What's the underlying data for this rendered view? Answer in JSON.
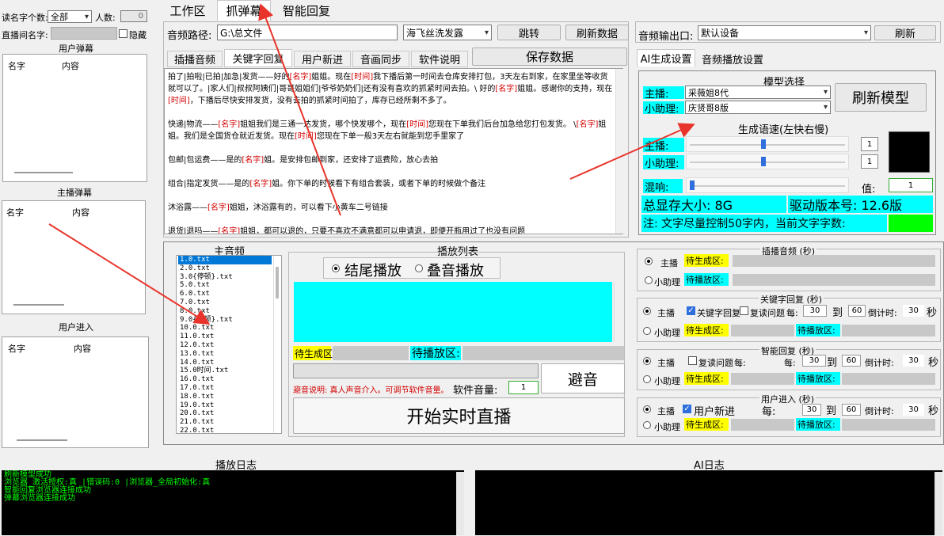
{
  "left": {
    "read_count_label": "读名字个数:",
    "read_count_value": "全部",
    "people_label": "人数:",
    "people_value": "0",
    "room_label": "直播间名字:",
    "hide_label": "隐藏",
    "user_danmu_title": "用户弹幕",
    "host_danmu_title": "主播弹幕",
    "user_enter_title": "用户进入",
    "col_name": "名字",
    "col_content": "内容"
  },
  "tabs": [
    "工作区",
    "抓弹幕",
    "智能回复"
  ],
  "audio_path_label": "音频路径:",
  "audio_path_value": "G:\\总文件",
  "voice_select": "海飞丝洗发露",
  "jump_button": "跳转",
  "refresh_data_button": "刷新数据",
  "audio_out_label": "音频输出口:",
  "audio_out_value": "默认设备",
  "refresh_button": "刷新",
  "subtabs": [
    "插播音频",
    "关键字回复",
    "用户新进",
    "音画同步",
    "软件说明"
  ],
  "save_button": "保存数据",
  "right_tabs": [
    "AI生成设置",
    "音频播放设置"
  ],
  "script_lines": [
    [
      [
        "拍了|拍啦|已拍|加急|发货——好的",
        0
      ],
      [
        "[名字]",
        1
      ],
      [
        "姐姐。现在",
        0
      ],
      [
        "[时间]",
        1
      ],
      [
        "我下播后第一时间去仓库安排打包，3天左右到家，在家里坐等收货就可以了。|家人们|叔叔阿姨们|哥哥姐姐们|爷爷奶奶们|还有没有喜欢的抓紧时间去拍。\\    好的",
        0
      ],
      [
        "[名字]",
        1
      ],
      [
        "姐姐。感谢你的支持，现在",
        0
      ],
      [
        "[时间]",
        1
      ],
      [
        "，下播后尽快安排发货，没有去拍的抓紧时间拍了，库存已经所剩不多了。",
        0
      ]
    ],
    [
      [
        "快递|物流——",
        0
      ],
      [
        "[名字]",
        1
      ],
      [
        "姐姐我们是三通一达发货，哪个快发哪个，现在",
        0
      ],
      [
        "[时间]",
        1
      ],
      [
        "您现在下单我们后台加急给您打包发货。      \\",
        0
      ],
      [
        "[名字]",
        1
      ],
      [
        "姐姐。我们是全国货仓就近发货。现在",
        0
      ],
      [
        "[时间]",
        1
      ],
      [
        "您现在下单一般3天左右就能到您手里家了",
        0
      ]
    ],
    [
      [
        "包邮|包运费——是的",
        0
      ],
      [
        "[名字]",
        1
      ],
      [
        "姐。是安排包邮到家，还安排了运费险，放心去拍",
        0
      ]
    ],
    [
      [
        "组合|指定发货——是的",
        0
      ],
      [
        "[名字]",
        1
      ],
      [
        "姐。你下单的时候看下有组合套装，或者下单的时候做个备注",
        0
      ]
    ],
    [
      [
        "沐浴露——",
        0
      ],
      [
        "[名字]",
        1
      ],
      [
        "姐姐，沐浴露有的，可以看下小黄车二号链接",
        0
      ]
    ],
    [
      [
        "退货|退吗——",
        0
      ],
      [
        "[名字]",
        1
      ],
      [
        "姐姐，都可以退的，只要不喜欢不满意都可以申请退，即便开瓶用过了也没有问题",
        0
      ]
    ]
  ],
  "model": {
    "title": "模型选择",
    "host_label": "主播:",
    "host_value": "采薇姐8代",
    "assist_label": "小助理:",
    "assist_value": "庆贤哥8版",
    "refresh_button": "刷新模型",
    "speed_title": "生成语速(左快右慢)",
    "speed_host_value": "1",
    "speed_assist_value": "1",
    "reverb_label": "混响:",
    "reverb_value_label": "值:",
    "reverb_value": "1",
    "vram": "总显存大小: 8G",
    "driver": "驱动版本号: 12.6版",
    "note": "注: 文字尽量控制50字内，当前文字字数:"
  },
  "host_audio": {
    "title": "主音频",
    "items": [
      "1.0.txt",
      "2.0.txt",
      "3.0{停顿}.txt",
      "5.0.txt",
      "6.0.txt",
      "7.0.txt",
      "8.0.txt",
      "9.0{停顿}.txt",
      "10.0.txt",
      "11.0.txt",
      "12.0.txt",
      "13.0.txt",
      "14.0.txt",
      "15.0时间.txt",
      "16.0.txt",
      "17.0.txt",
      "18.0.txt",
      "19.0.txt",
      "20.0.txt",
      "21.0.txt",
      "22.0.txt"
    ]
  },
  "playlist": {
    "title": "播放列表",
    "mode_end": "结尾播放",
    "mode_overlay": "叠音播放",
    "pending_gen": "待生成区:",
    "pending_play": "待播放区:",
    "avoid_button": "避音",
    "avoid_note": "避音说明: 真人声音介入。可调节软件音量。",
    "volume_label": "软件音量:",
    "volume_value": "1",
    "start_button": "开始实时直播"
  },
  "insert_audio": {
    "title": "插播音频 (秒)",
    "host": "主播",
    "assist": "小助理",
    "pending_gen": "待生成区:",
    "pending_play": "待播放区:"
  },
  "keyword_reply": {
    "title": "关键字回复 (秒)",
    "host": "主播",
    "assist": "小助理",
    "kw_check": "关键字回复",
    "repeat_check": "复读问题",
    "every": "每:",
    "from": "30",
    "to_label": "到",
    "to": "60",
    "countdown": "倒计时:",
    "count": "30",
    "sec": "秒",
    "pending_gen": "待生成区:",
    "pending_play": "待播放区:"
  },
  "smart_reply": {
    "title": "智能回复 (秒)",
    "host": "主播",
    "assist": "小助理",
    "repeat_check": "复读问题",
    "every1": "每:",
    "every2": "每:",
    "from": "30",
    "to_label": "到",
    "to": "60",
    "countdown": "倒计时:",
    "count": "30",
    "sec": "秒",
    "pending_gen": "待生成区:",
    "pending_play": "待播放区:"
  },
  "user_enter": {
    "title": "用户进入 (秒)",
    "host": "主播",
    "assist": "小助理",
    "new_check": "用户新进",
    "every": "每:",
    "from": "30",
    "to_label": "到",
    "to": "60",
    "countdown": "倒计时:",
    "count": "30",
    "sec": "秒",
    "pending_gen": "待生成区:",
    "pending_play": "待播放区:"
  },
  "play_log": {
    "title": "播放日志",
    "lines": [
      "刷新模型成功",
      "浏览器_激活授权:真  |错误码:0  |浏览器_全局初始化:真",
      "智能回复浏览器连接成功",
      "弹幕浏览器连接成功"
    ]
  },
  "ai_log": {
    "title": "AI日志"
  },
  "colors": {
    "cyan": "#00ffff",
    "yellow": "#ffff00",
    "green": "#00ff00",
    "red": "#d40000",
    "arrow": "#e8342a"
  }
}
